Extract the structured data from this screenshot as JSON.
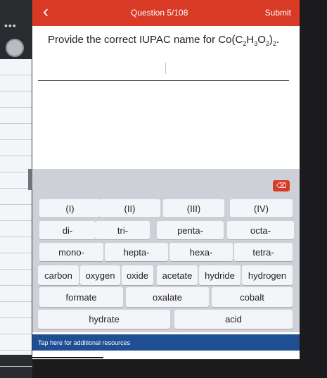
{
  "header": {
    "back_icon": "chevron-left-icon",
    "question_label": "Question 5/108",
    "submit_label": "Submit"
  },
  "prompt": {
    "text_before": "Provide the correct IUPAC name for ",
    "formula": "Co(C2H3O2)2."
  },
  "keyboard": {
    "backspace_icon": "backspace-icon",
    "row1": [
      "(I)",
      "(II)",
      "(III)",
      "(IV)"
    ],
    "row2": [
      "di-",
      "tri-",
      "penta-",
      "octa-"
    ],
    "row3": [
      "mono-",
      "hepta-",
      "hexa-",
      "tetra-"
    ],
    "row4": [
      "carbon",
      "oxygen",
      "oxide",
      "acetate",
      "hydride",
      "hydrogen"
    ],
    "row5": [
      "formate",
      "oxalate",
      "cobalt"
    ],
    "row6": [
      "hydrate",
      "acid"
    ]
  },
  "footer": {
    "resources_label": "Tap here for additional resources"
  },
  "colors": {
    "header": "#d83a26",
    "resources_bar": "#1e4f94",
    "keyboard_bg": "#cdd0d6",
    "key_bg": "#f4f5f8"
  },
  "sidebar": {
    "dots_icon": "ellipsis-icon",
    "profile_icon": "avatar-icon"
  }
}
